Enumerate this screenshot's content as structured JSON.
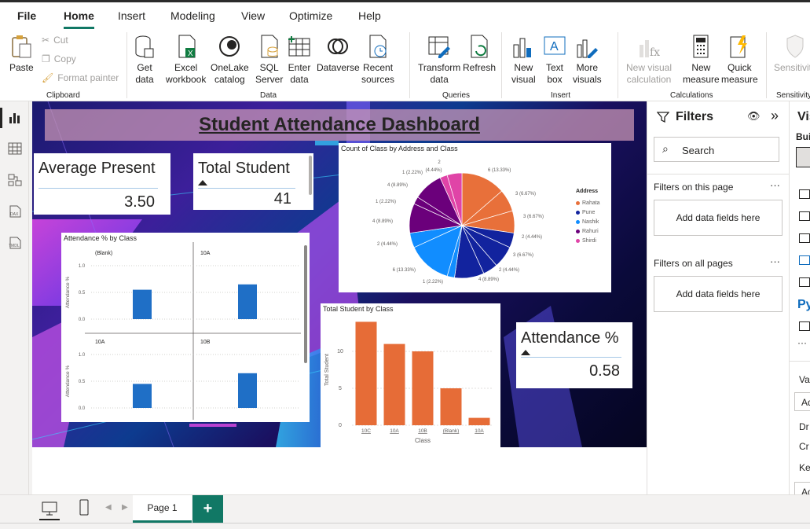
{
  "menu": {
    "tabs": [
      "File",
      "Home",
      "Insert",
      "Modeling",
      "View",
      "Optimize",
      "Help"
    ],
    "active": "Home"
  },
  "ribbon": {
    "clipboard": {
      "paste": "Paste",
      "cut": "Cut",
      "copy": "Copy",
      "format_painter": "Format painter",
      "group": "Clipboard"
    },
    "data": {
      "get_data": [
        "Get",
        "data"
      ],
      "excel": [
        "Excel",
        "workbook"
      ],
      "onelake": [
        "OneLake",
        "catalog"
      ],
      "sql": [
        "SQL",
        "Server"
      ],
      "enter": [
        "Enter",
        "data"
      ],
      "dataverse": [
        "Dataverse",
        ""
      ],
      "recent": [
        "Recent",
        "sources"
      ],
      "group": "Data"
    },
    "queries": {
      "transform": [
        "Transform",
        "data"
      ],
      "refresh": [
        "Refresh",
        ""
      ],
      "group": "Queries"
    },
    "insert": {
      "new_visual": [
        "New",
        "visual"
      ],
      "text_box": [
        "Text",
        "box"
      ],
      "more_visuals": [
        "More",
        "visuals"
      ],
      "group": "Insert"
    },
    "calculations": {
      "new_visual_calc": [
        "New visual",
        "calculation"
      ],
      "new_measure": [
        "New",
        "measure"
      ],
      "quick_measure": [
        "Quick",
        "measure"
      ],
      "group": "Calculations"
    },
    "sensitivity": {
      "label": "Sensitivity",
      "group": "Sensitivity"
    }
  },
  "dashboard": {
    "title": "Student Attendance Dashboard",
    "cards": {
      "avg_present": {
        "label": "Average Present",
        "value": "3.50"
      },
      "total_student": {
        "label": "Total Student",
        "value": "41"
      },
      "attendance_pct": {
        "label": "Attendance %",
        "value": "0.58"
      }
    }
  },
  "pie_chart": {
    "title": "Count of Class by Address and Class",
    "legend_title": "Address",
    "legend": [
      {
        "name": "Rahata",
        "color": "#e8703a"
      },
      {
        "name": "Pune",
        "color": "#12239e"
      },
      {
        "name": "Nashik",
        "color": "#118dff"
      },
      {
        "name": "Rahuri",
        "color": "#6b007b"
      },
      {
        "name": "Shirdi",
        "color": "#e044a7"
      }
    ],
    "slice_labels": [
      "6 (13.33%)",
      "3 (6.67%)",
      "3 (6.67%)",
      "2 (4.44%)",
      "3 (6.67%)",
      "2 (4.44%)",
      "4 (8.89%)",
      "1 (2.22%)",
      "6 (13.33%)",
      "2 (4.44%)",
      "4 (8.89%)",
      "1 (2.22%)",
      "4 (8.89%)",
      "1 (2.22%)",
      "2",
      "(4.44%)"
    ]
  },
  "bar_chart": {
    "title": "Total Student by Class",
    "xlabel": "Class",
    "ylabel": "Total Student",
    "yticks": [
      "0",
      "5",
      "10"
    ]
  },
  "small_multiples": {
    "title": "Attendance % by Class",
    "ylabel": "Attendance %",
    "yticks": [
      "0.0",
      "0.5",
      "1.0"
    ],
    "panels": [
      {
        "label": "(Blank)"
      },
      {
        "label": "10A"
      },
      {
        "label": "10A"
      },
      {
        "label": "10B"
      }
    ]
  },
  "chart_data": [
    {
      "type": "pie",
      "title": "Count of Class by Address and Class",
      "legend_title": "Address",
      "categories": [
        "Rahata",
        "Pune",
        "Nashik",
        "Rahuri",
        "Shirdi"
      ],
      "slices": [
        {
          "address": "Rahata",
          "value": 6
        },
        {
          "address": "Rahata",
          "value": 3
        },
        {
          "address": "Rahata",
          "value": 3
        },
        {
          "address": "Pune",
          "value": 2
        },
        {
          "address": "Pune",
          "value": 3
        },
        {
          "address": "Pune",
          "value": 2
        },
        {
          "address": "Pune",
          "value": 4
        },
        {
          "address": "Nashik",
          "value": 1
        },
        {
          "address": "Nashik",
          "value": 6
        },
        {
          "address": "Nashik",
          "value": 2
        },
        {
          "address": "Rahuri",
          "value": 4
        },
        {
          "address": "Rahuri",
          "value": 1
        },
        {
          "address": "Rahuri",
          "value": 4
        },
        {
          "address": "Shirdi",
          "value": 1
        },
        {
          "address": "Shirdi",
          "value": 2
        }
      ]
    },
    {
      "type": "bar",
      "title": "Total Student by Class",
      "categories": [
        "10C",
        "10A",
        "10B",
        "(Blank)",
        "10A"
      ],
      "values": [
        14,
        11,
        10,
        5,
        1
      ],
      "xlabel": "Class",
      "ylabel": "Total Student",
      "ylim": [
        0,
        15
      ],
      "color": "#e66c37"
    },
    {
      "type": "bar",
      "title": "Attendance % by Class",
      "ylabel": "Attendance %",
      "panels": [
        "(Blank)",
        "10A",
        "10A",
        "10B"
      ],
      "values": [
        0.55,
        0.65,
        0.45,
        0.65
      ],
      "ylim": [
        0,
        1.0
      ],
      "color": "#1f6fc6"
    }
  ],
  "filters": {
    "title": "Filters",
    "search_placeholder": "Search",
    "this_page": "Filters on this page",
    "all_pages": "Filters on all pages",
    "add_fields": "Add data fields here"
  },
  "viz_pane": {
    "title": "Vis",
    "build": "Bui",
    "py": "Py",
    "va": "Va",
    "ad": "Ad",
    "dr": "Dr",
    "cr": "Cr",
    "ke": "Ke"
  },
  "pages": {
    "tabs": [
      "Page 1"
    ],
    "add": "+"
  }
}
